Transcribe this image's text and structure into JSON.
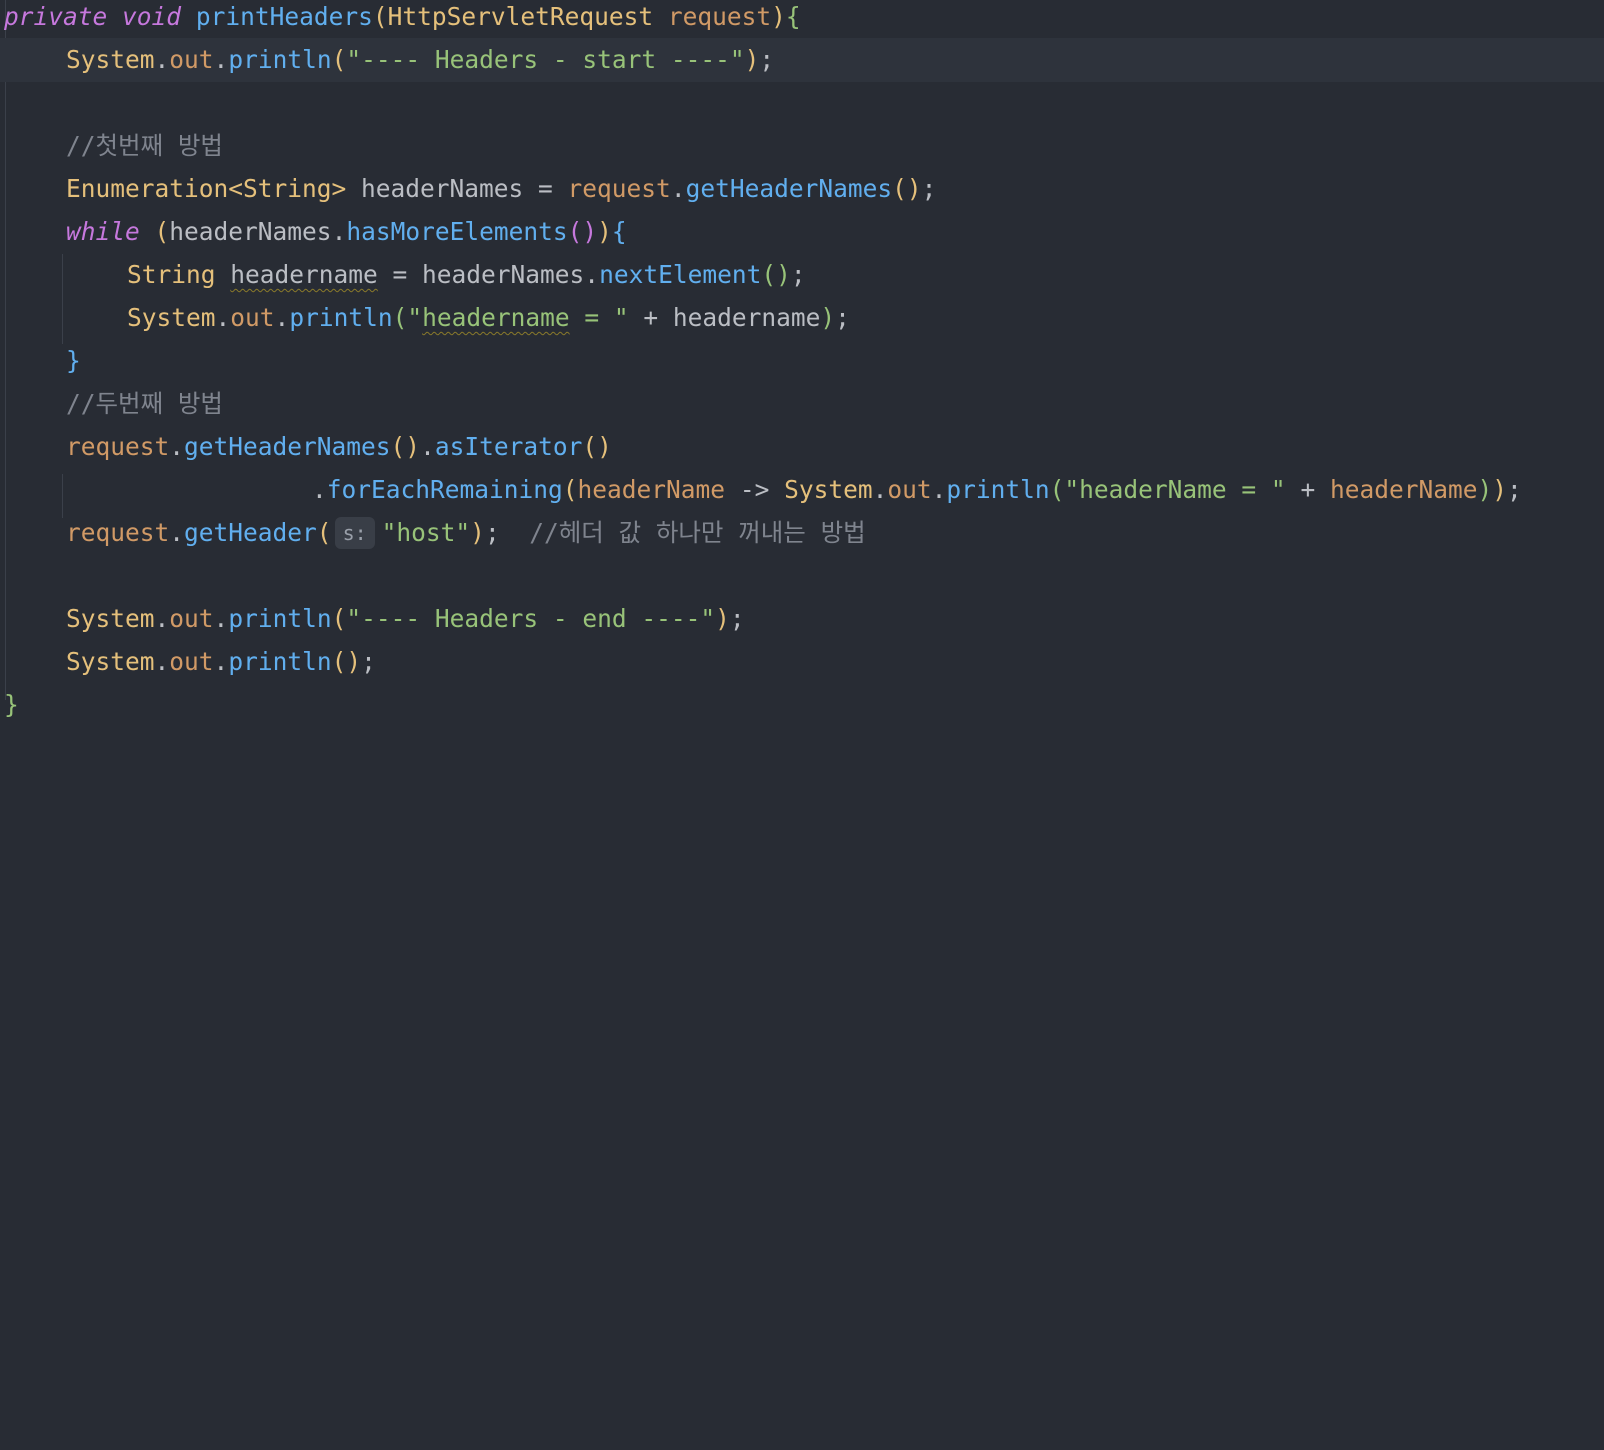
{
  "code": {
    "line1": {
      "kw_private": "private",
      "kw_void": "void",
      "method_name": "printHeaders",
      "open_paren": "(",
      "param_type": "HttpServletRequest",
      "param_name": "request",
      "close": ")",
      "brace": "{"
    },
    "line2": {
      "cls": "System",
      "dot1": ".",
      "field": "out",
      "dot2": ".",
      "fn": "println",
      "open": "(",
      "str": "\"---- Headers - start ----\"",
      "close": ")",
      "semi": ";"
    },
    "line3": {
      "comment": "//첫번째 방법"
    },
    "line4": {
      "cls": "Enumeration",
      "generic": "<String>",
      "var_decl": " headerNames = ",
      "recv": "request",
      "dot": ".",
      "fn": "getHeaderNames",
      "parens": "()",
      "semi": ";"
    },
    "line5": {
      "kw": "while",
      "sp": " ",
      "open": "(",
      "recv": "headerNames",
      "dot": ".",
      "fn": "hasMoreElements",
      "parens": "()",
      "close": ")",
      "brace": "{"
    },
    "line6": {
      "cls": "String",
      "sp": " ",
      "var": "headername",
      "eq": " = headerNames.",
      "fn": "nextElement",
      "parens": "()",
      "semi": ";"
    },
    "line7": {
      "cls": "System",
      "dot1": ".",
      "field": "out",
      "dot2": ".",
      "fn": "println",
      "open": "(",
      "str_q": "\"",
      "str_var": "headername",
      "str_rest": " = \"",
      "plus": " + headername",
      "close": ")",
      "semi": ";"
    },
    "line8": {
      "brace": "}"
    },
    "line9": {
      "comment": "//두번째 방법"
    },
    "line10": {
      "recv": "request",
      "dot1": ".",
      "fn1": "getHeaderNames",
      "parens1": "()",
      "dot2": ".",
      "fn2": "asIterator",
      "parens2": "()"
    },
    "line11": {
      "dot1": ".",
      "fn": "forEachRemaining",
      "open": "(",
      "lambda_param": "headerName",
      "arrow": " -> ",
      "cls": "System",
      "dot2": ".",
      "field": "out",
      "dot3": ".",
      "fn2": "println",
      "open2": "(",
      "str": "\"headerName = \"",
      "plus": " + ",
      "var": "headerName",
      "close2": ")",
      "close": ")",
      "semi": ";"
    },
    "line12": {
      "recv": "request",
      "dot": ".",
      "fn": "getHeader",
      "open": "(",
      "hint": "s:",
      "str": "\"host\"",
      "close": ")",
      "semi": ";",
      "gap": "  ",
      "comment": "//헤더 값 하나만 꺼내는 방법"
    },
    "line14": {
      "cls": "System",
      "dot1": ".",
      "field": "out",
      "dot2": ".",
      "fn": "println",
      "open": "(",
      "str": "\"---- Headers - end ----\"",
      "close": ")",
      "semi": ";"
    },
    "line15": {
      "cls": "System",
      "dot1": ".",
      "field": "out",
      "dot2": ".",
      "fn": "println",
      "parens": "()",
      "semi": ";"
    },
    "line16": {
      "brace": "}"
    }
  }
}
